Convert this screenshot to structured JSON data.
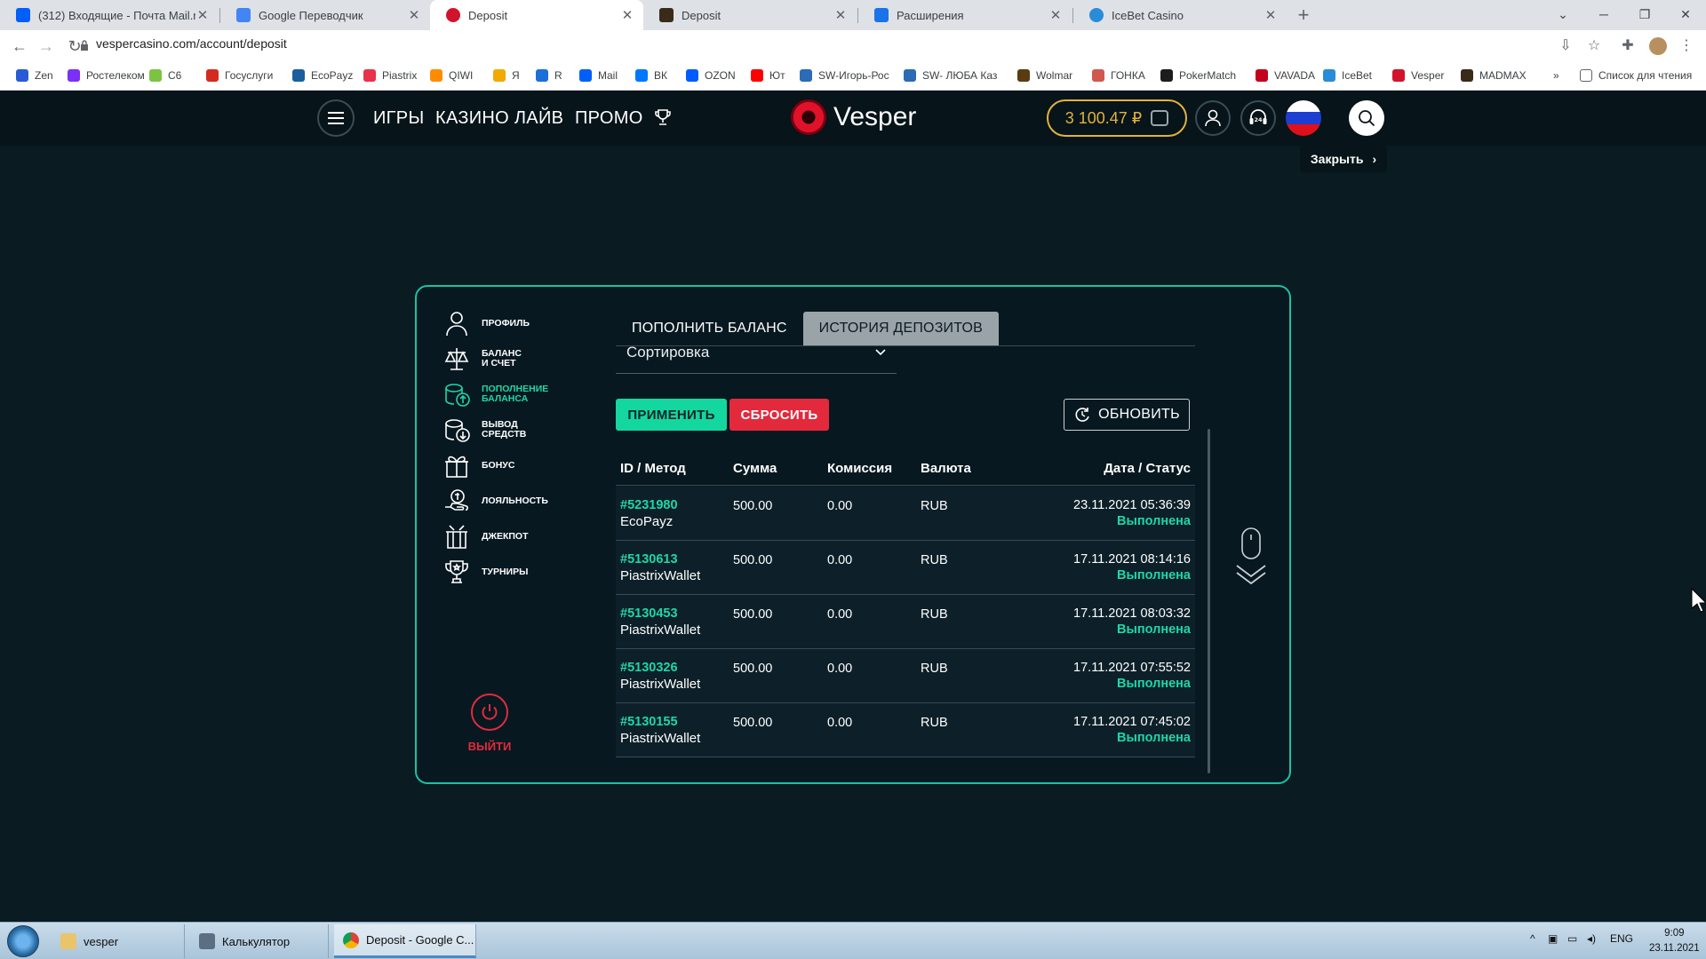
{
  "browser": {
    "tabs": [
      {
        "title": "(312) Входящие - Почта Mail.ru",
        "color": "#005ff9",
        "active": false
      },
      {
        "title": "Google Переводчик",
        "color": "#4285f4",
        "active": false
      },
      {
        "title": "Deposit",
        "color": "#d2132c",
        "active": true
      },
      {
        "title": "Deposit",
        "color": "#3a2a1a",
        "active": false
      },
      {
        "title": "Расширения",
        "color": "#1a73e8",
        "active": false
      },
      {
        "title": "IceBet Casino",
        "color": "#2a8bd8",
        "active": false
      }
    ],
    "url": "vespercasino.com/account/deposit",
    "bookmarks": [
      {
        "label": "Zen",
        "color": "#2a5bd7"
      },
      {
        "label": "Ростелеком",
        "color": "#7b2ff7"
      },
      {
        "label": "C6",
        "color": "#7cc342"
      },
      {
        "label": "Госуслуги",
        "color": "#d52b1e"
      },
      {
        "label": "EcoPayz",
        "color": "#1a5e9e"
      },
      {
        "label": "Piastrix",
        "color": "#e8334a"
      },
      {
        "label": "QIWI",
        "color": "#ff8c00"
      },
      {
        "label": "Я",
        "color": "#f2a900"
      },
      {
        "label": "R",
        "color": "#1c6fd8"
      },
      {
        "label": "Mail",
        "color": "#005ff9"
      },
      {
        "label": "ВК",
        "color": "#0077ff"
      },
      {
        "label": "OZON",
        "color": "#005bff"
      },
      {
        "label": "Ют",
        "color": "#ff0000"
      },
      {
        "label": "SW-Игорь-Рос",
        "color": "#2c6bb5"
      },
      {
        "label": "SW- ЛЮБА Каз",
        "color": "#2c6bb5"
      },
      {
        "label": "Wolmar",
        "color": "#5a3b12"
      },
      {
        "label": "ГОНКА",
        "color": "#d0584d"
      },
      {
        "label": "PokerMatch",
        "color": "#1c1c1c"
      },
      {
        "label": "VAVADA",
        "color": "#c4001c"
      },
      {
        "label": "IceBet",
        "color": "#2a8bd8"
      },
      {
        "label": "Vesper",
        "color": "#d2132c"
      },
      {
        "label": "MADMAX",
        "color": "#3a2a1a"
      }
    ],
    "bookmarks_more": "»",
    "reading_list": "Список для чтения"
  },
  "site": {
    "nav": {
      "games": "ИГРЫ",
      "live": "КАЗИНО ЛАЙВ",
      "promo": "ПРОМО"
    },
    "logo_text": "Vesper",
    "balance": "3 100.47 ₽",
    "close_tooltip": "Закрыть",
    "accent": "#1ed7a8"
  },
  "sidebar": {
    "items": [
      {
        "label1": "ПРОФИЛЬ",
        "label2": "",
        "icon": "user-icon",
        "active": false
      },
      {
        "label1": "БАЛАНС",
        "label2": "И СЧЕТ",
        "icon": "scales-icon",
        "active": false
      },
      {
        "label1": "ПОПОЛНЕНИЕ",
        "label2": "БАЛАНСА",
        "icon": "deposit-coins-icon",
        "active": true
      },
      {
        "label1": "ВЫВОД",
        "label2": "СРЕДСТВ",
        "icon": "withdraw-coins-icon",
        "active": false
      },
      {
        "label1": "БОНУС",
        "label2": "",
        "icon": "gift-icon",
        "active": false
      },
      {
        "label1": "ЛОЯЛЬНОСТЬ",
        "label2": "",
        "icon": "loyalty-icon",
        "active": false
      },
      {
        "label1": "ДЖЕКПОТ",
        "label2": "",
        "icon": "jackpot-icon",
        "active": false
      },
      {
        "label1": "ТУРНИРЫ",
        "label2": "",
        "icon": "trophy-icon",
        "active": false
      }
    ],
    "logout": "ВЫЙТИ"
  },
  "panel": {
    "tabs": [
      {
        "label": "ПОПОЛНИТЬ БАЛАНС",
        "active": false
      },
      {
        "label": "ИСТОРИЯ ДЕПОЗИТОВ",
        "active": true
      }
    ],
    "sort_label": "Сортировка",
    "apply": "ПРИМЕНИТЬ",
    "reset": "СБРОСИТЬ",
    "refresh": "ОБНОВИТЬ",
    "columns": [
      "ID / Метод",
      "Сумма",
      "Комиссия",
      "Валюта",
      "Дата / Статус"
    ],
    "rows": [
      {
        "id": "#5231980",
        "method": "EcoPayz",
        "amount": "500.00",
        "fee": "0.00",
        "currency": "RUB",
        "date": "23.11.2021 05:36:39",
        "status": "Выполнена"
      },
      {
        "id": "#5130613",
        "method": "PiastrixWallet",
        "amount": "500.00",
        "fee": "0.00",
        "currency": "RUB",
        "date": "17.11.2021 08:14:16",
        "status": "Выполнена"
      },
      {
        "id": "#5130453",
        "method": "PiastrixWallet",
        "amount": "500.00",
        "fee": "0.00",
        "currency": "RUB",
        "date": "17.11.2021 08:03:32",
        "status": "Выполнена"
      },
      {
        "id": "#5130326",
        "method": "PiastrixWallet",
        "amount": "500.00",
        "fee": "0.00",
        "currency": "RUB",
        "date": "17.11.2021 07:55:52",
        "status": "Выполнена"
      },
      {
        "id": "#5130155",
        "method": "PiastrixWallet",
        "amount": "500.00",
        "fee": "0.00",
        "currency": "RUB",
        "date": "17.11.2021 07:45:02",
        "status": "Выполнена"
      }
    ]
  },
  "taskbar": {
    "tasks": [
      {
        "label": "vesper",
        "color": "#e9c46a",
        "active": false
      },
      {
        "label": "Калькулятор",
        "color": "#5c6f82",
        "active": false
      },
      {
        "label": "Deposit - Google C...",
        "color": "#db4437",
        "active": true
      }
    ],
    "lang": "ENG",
    "time": "9:09",
    "date": "23.11.2021"
  }
}
